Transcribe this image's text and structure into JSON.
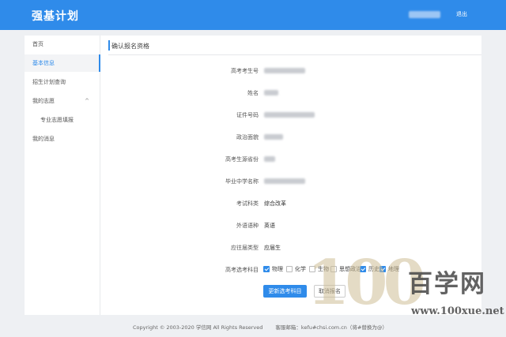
{
  "header": {
    "brand": "强基计划",
    "logout": "退出",
    "color": "#2f8bea"
  },
  "sidebar": {
    "items": [
      {
        "label": "首页"
      },
      {
        "label": "基本信息"
      },
      {
        "label": "招生计划查询"
      },
      {
        "label": "我的志愿"
      },
      {
        "label": "专业志愿填报"
      },
      {
        "label": "我的消息"
      }
    ],
    "chevron": "^"
  },
  "main": {
    "section_title": "确认报名资格",
    "fields": [
      {
        "label": "高考考生号"
      },
      {
        "label": "姓名"
      },
      {
        "label": "证件号码"
      },
      {
        "label": "政治面貌"
      },
      {
        "label": "高考生源省份"
      },
      {
        "label": "毕业中学名称"
      },
      {
        "label": "考试科类",
        "value": "综合改革"
      },
      {
        "label": "外语语种",
        "value": "英语"
      },
      {
        "label": "应往届类型",
        "value": "应届生"
      },
      {
        "label": "高考选考科目"
      }
    ],
    "subjects": [
      {
        "label": "物理",
        "checked": true
      },
      {
        "label": "化学",
        "checked": false
      },
      {
        "label": "生物",
        "checked": false
      },
      {
        "label": "思想政治",
        "checked": false
      },
      {
        "label": "历史",
        "checked": true
      },
      {
        "label": "地理",
        "checked": true
      }
    ],
    "buttons": {
      "update": "更新选考科目",
      "cancel": "取消报名"
    }
  },
  "footer": {
    "copyright": "Copyright © 2003-2020 学信网 All Rights Reserved",
    "contact": "客服邮箱：kefu#chsi.com.cn（将#替换为@）"
  },
  "watermark": {
    "number": "100",
    "name": "百学网",
    "url": "www.100xue.net"
  }
}
